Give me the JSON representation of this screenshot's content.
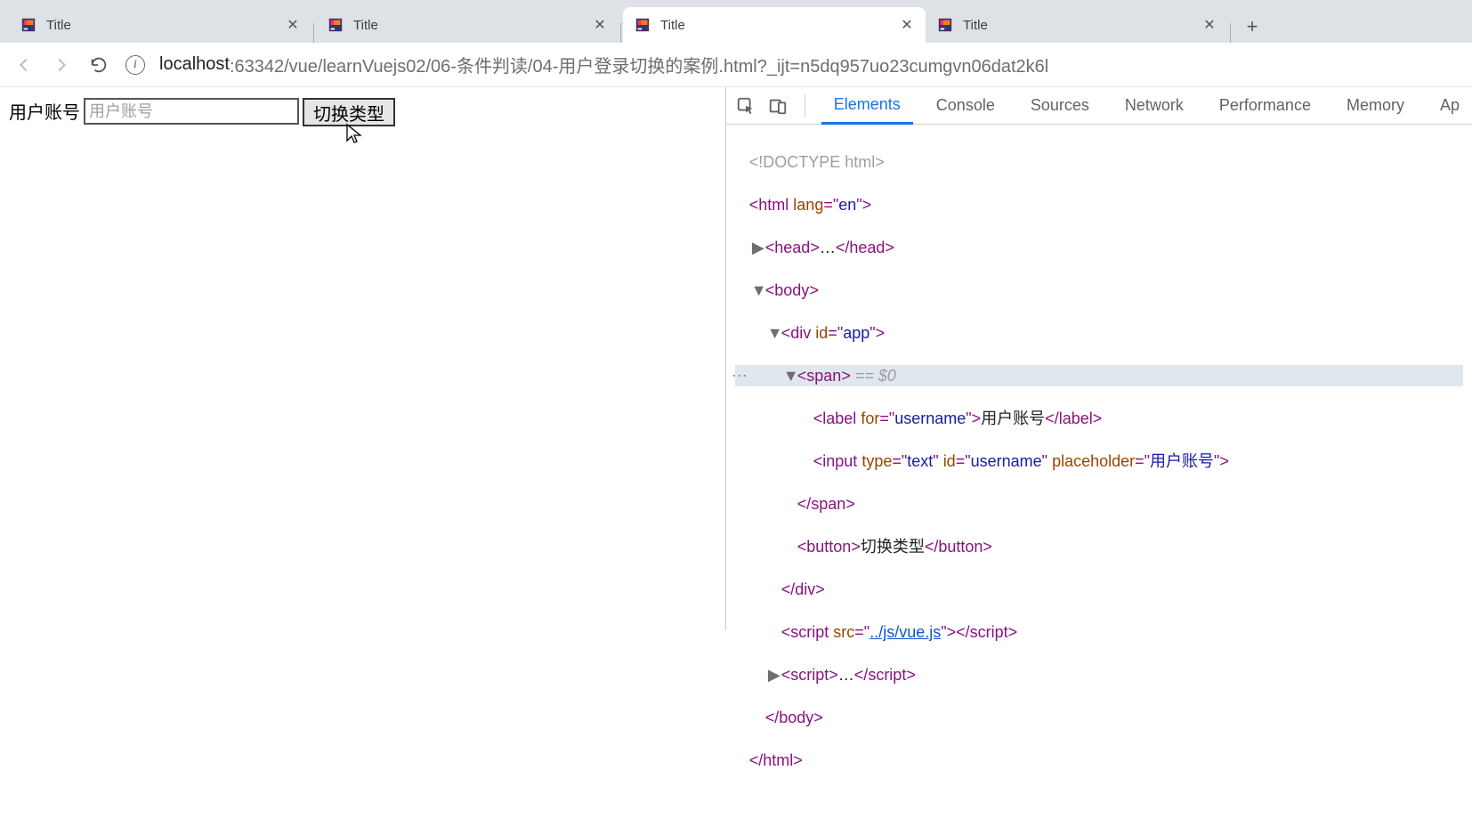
{
  "browser": {
    "tabs": [
      {
        "title": "Title",
        "active": false
      },
      {
        "title": "Title",
        "active": false
      },
      {
        "title": "Title",
        "active": true
      },
      {
        "title": "Title",
        "active": false
      }
    ],
    "url_host": "localhost",
    "url_port_path": ":63342/vue/learnVuejs02/06-条件判读/04-用户登录切换的案例.html?_ijt=n5dq957uo23cumgvn06dat2k6l"
  },
  "page": {
    "label": "用户账号",
    "placeholder": "用户账号",
    "input_value": "",
    "button": "切换类型"
  },
  "devtools": {
    "tabs": [
      "Elements",
      "Console",
      "Sources",
      "Network",
      "Performance",
      "Memory",
      "Ap"
    ],
    "active_tab": 0,
    "dom": {
      "doctype": "<!DOCTYPE html>",
      "html_open": {
        "tag": "html",
        "lang": "en"
      },
      "head": "head",
      "body": "body",
      "div": {
        "tag": "div",
        "id": "app"
      },
      "span": "span",
      "eq0": " == $0",
      "label": {
        "tag": "label",
        "for": "username",
        "text": "用户账号"
      },
      "input": {
        "tag": "input",
        "type": "text",
        "id": "username",
        "placeholder": "用户账号"
      },
      "button": {
        "tag": "button",
        "text": "切换类型"
      },
      "script_src": "../js/vue.js",
      "script_inline": "script"
    }
  }
}
